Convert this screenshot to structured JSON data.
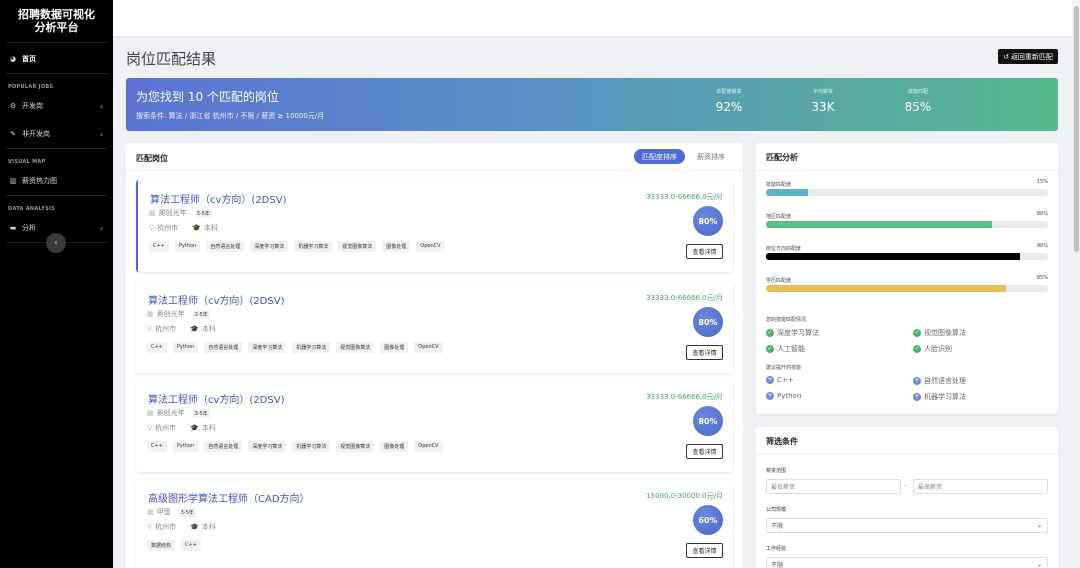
{
  "sidebar": {
    "brand": "招聘数据可视化分析平台",
    "home": "首页",
    "popular_heading": "POPULAR JOBS",
    "dev_jobs": "开发岗",
    "non_dev_jobs": "非开发岗",
    "visual_heading": "VISUAL MAP",
    "salary_heatmap": "薪资热力图",
    "data_heading": "DATA ANALYSIS",
    "analysis": "分析",
    "collapse": "‹"
  },
  "page": {
    "title": "岗位匹配结果",
    "back_button": "返回重新匹配"
  },
  "banner": {
    "title": "为您找到 10 个匹配的岗位",
    "criteria": "搜索条件: 算法 / 浙江省 杭州市 / 不限 / 薪资 ≥ 10000元/月",
    "stats": [
      {
        "label": "匹配度最高",
        "value": "92%"
      },
      {
        "label": "平均薪资",
        "value": "33K"
      },
      {
        "label": "技能匹配",
        "value": "85%"
      }
    ]
  },
  "list": {
    "heading": "匹配岗位",
    "sort_match": "匹配度排序",
    "sort_salary": "薪资排序",
    "detail_label": "查看详情",
    "jobs": [
      {
        "title": "算法工程师（cv方向）(2DSV)",
        "salary": "33333.0-66666.0元/月",
        "company": "奥创光年",
        "exp": "3-5年",
        "city": "杭州市",
        "edu": "本科",
        "match": "80%",
        "tags": [
          "C++",
          "Python",
          "自然语言处理",
          "深度学习算法",
          "机器学习算法",
          "视觉图像算法",
          "图像处理",
          "OpenCV"
        ]
      },
      {
        "title": "算法工程师（cv方向）(2DSV)",
        "salary": "33333.0-66666.0元/月",
        "company": "奥创光年",
        "exp": "3-5年",
        "city": "杭州市",
        "edu": "本科",
        "match": "80%",
        "tags": [
          "C++",
          "Python",
          "自然语言处理",
          "深度学习算法",
          "机器学习算法",
          "视觉图像算法",
          "图像处理",
          "OpenCV"
        ]
      },
      {
        "title": "算法工程师（cv方向）(2DSV)",
        "salary": "33333.0-66666.0元/月",
        "company": "奥创光年",
        "exp": "3-5年",
        "city": "杭州市",
        "edu": "本科",
        "match": "80%",
        "tags": [
          "C++",
          "Python",
          "自然语言处理",
          "深度学习算法",
          "机器学习算法",
          "视觉图像算法",
          "图像处理",
          "OpenCV"
        ]
      },
      {
        "title": "高级图形学算法工程师（CAD方向）",
        "salary": "15000.0-30000.0元/月",
        "company": "甲蛋",
        "exp": "3-5年",
        "city": "杭州市",
        "edu": "本科",
        "match": "60%",
        "tags": [
          "数据结构",
          "C++"
        ]
      }
    ]
  },
  "analysis": {
    "heading": "匹配分析",
    "bars": [
      {
        "label": "技能匹配度",
        "pct": "15%",
        "value": 0.15,
        "color": "#5bb3c9"
      },
      {
        "label": "地区匹配度",
        "pct": "80%",
        "value": 0.8,
        "color": "#57bf87"
      },
      {
        "label": "岗位方向匹配度",
        "pct": "90%",
        "value": 0.9,
        "color": "#000000"
      },
      {
        "label": "学历匹配度",
        "pct": "85%",
        "value": 0.85,
        "color": "#e7be5a"
      }
    ],
    "matched_heading": "您的技能匹配情况",
    "matched": [
      "深度学习算法",
      "视觉图像算法",
      "人工智能",
      "人脸识别"
    ],
    "suggest_heading": "建议提升的技能",
    "suggested": [
      "C++",
      "自然语言处理",
      "Python",
      "机器学习算法"
    ]
  },
  "filter": {
    "heading": "筛选条件",
    "salary_label": "薪资范围",
    "min_placeholder": "最低薪资",
    "separator": "-",
    "max_placeholder": "最高薪资",
    "company_label": "公司规模",
    "company_value": "不限",
    "exp_label": "工作经验",
    "exp_value": "不限"
  }
}
